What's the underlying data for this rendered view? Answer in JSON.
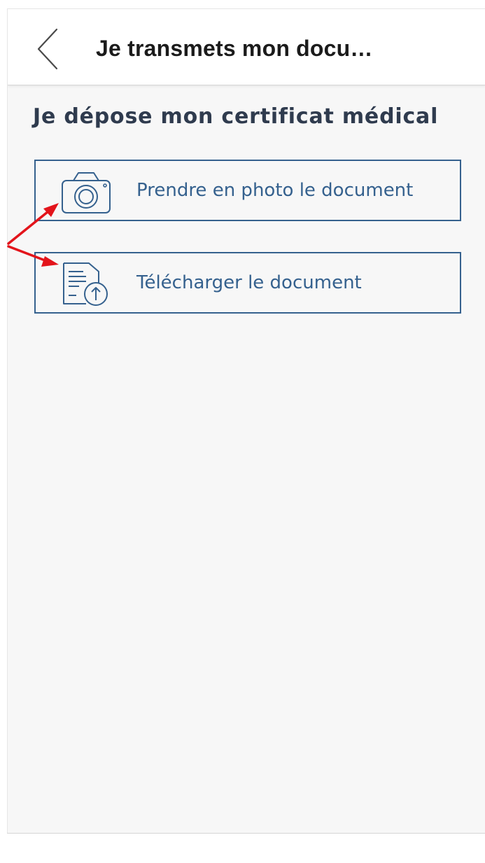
{
  "header": {
    "title": "Je transmets mon docu…",
    "back_icon": "chevron-left-icon"
  },
  "main": {
    "section_title": "Je dépose mon certificat médical",
    "options": [
      {
        "label": "Prendre en photo le document",
        "icon": "camera-icon"
      },
      {
        "label": "Télécharger le document",
        "icon": "document-upload-icon"
      }
    ]
  },
  "colors": {
    "accent": "#35618e",
    "section_title": "#2f3b4e",
    "background": "#f7f7f7",
    "annotation_arrow": "#e3141b"
  }
}
